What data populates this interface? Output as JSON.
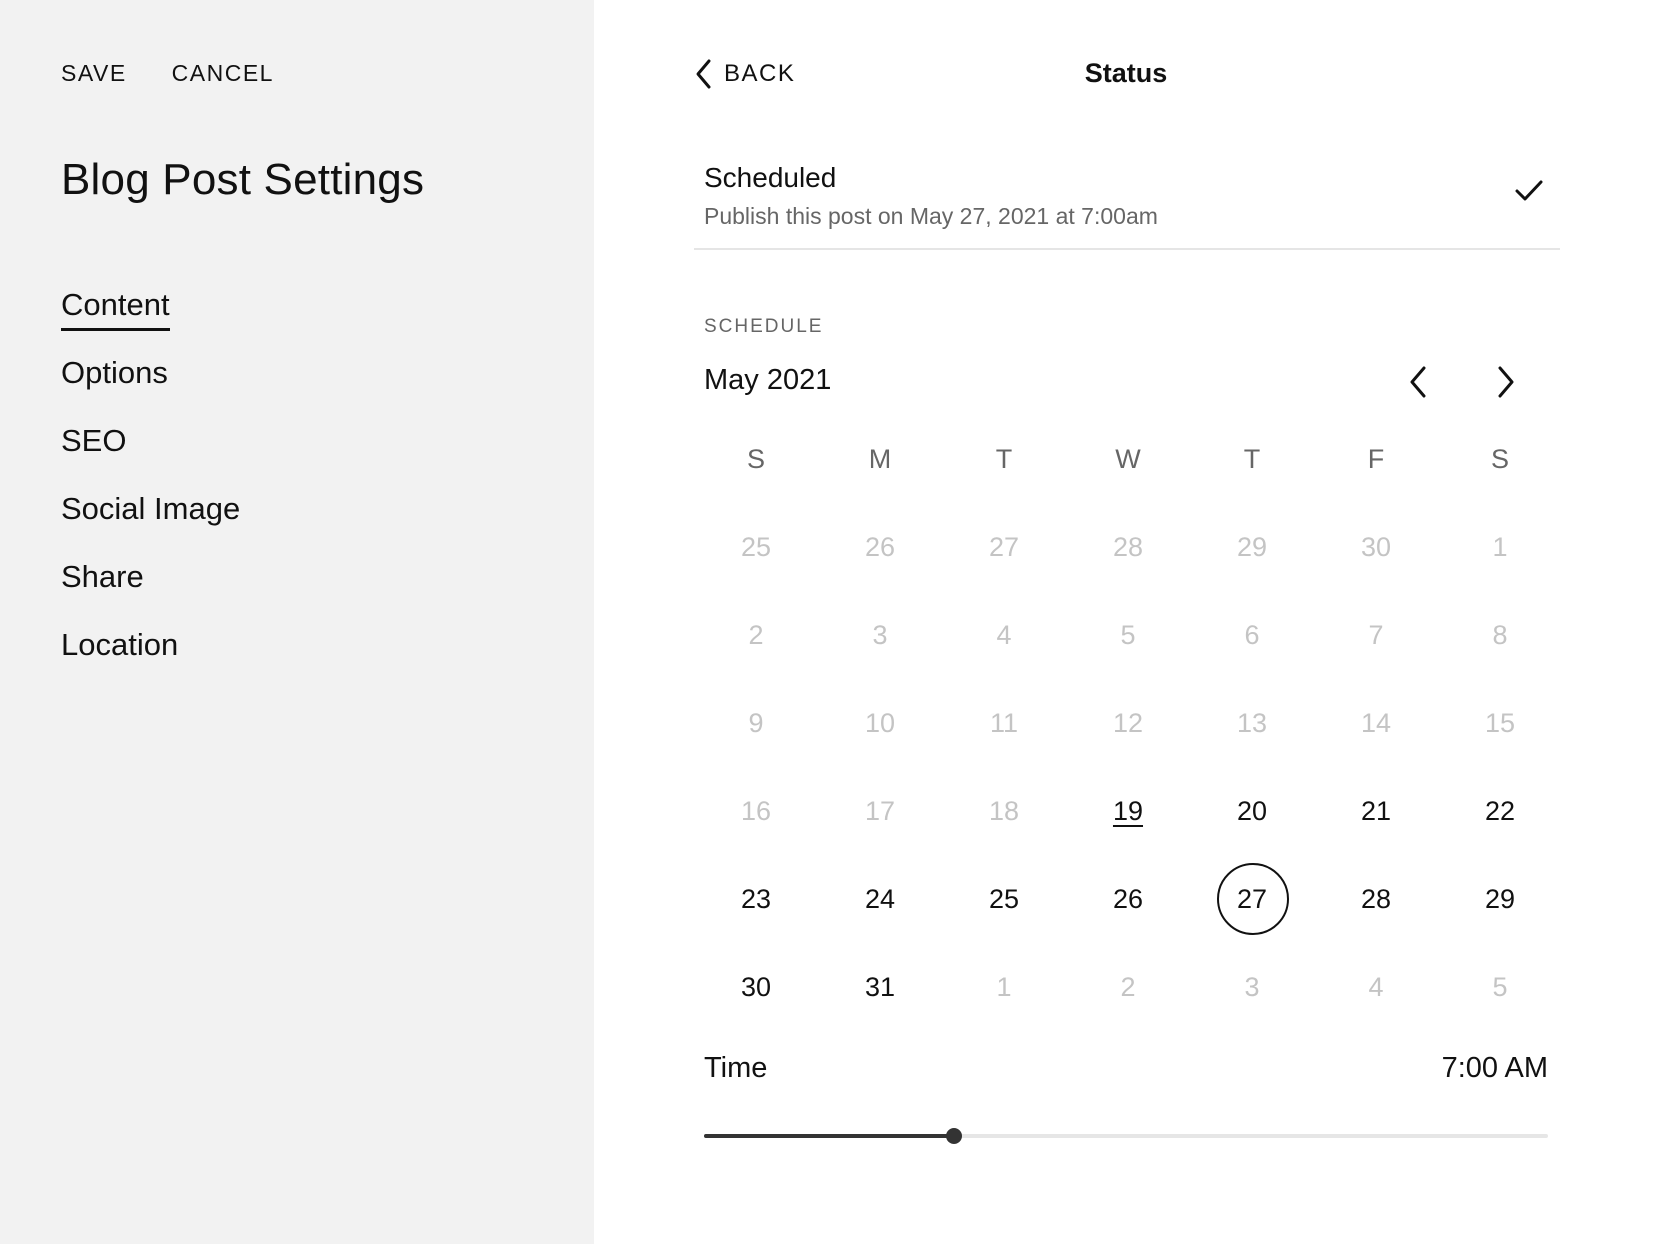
{
  "actions": {
    "save": "SAVE",
    "cancel": "CANCEL"
  },
  "panel": {
    "title": "Blog Post Settings",
    "nav": [
      {
        "label": "Content",
        "active": true
      },
      {
        "label": "Options"
      },
      {
        "label": "SEO"
      },
      {
        "label": "Social Image"
      },
      {
        "label": "Share"
      },
      {
        "label": "Location"
      }
    ]
  },
  "header": {
    "back_label": "BACK",
    "title": "Status"
  },
  "status": {
    "title": "Scheduled",
    "description": "Publish this post on May 27, 2021 at 7:00am",
    "checked": true
  },
  "schedule": {
    "section_label": "SCHEDULE",
    "month": "May 2021",
    "weekdays": [
      "S",
      "M",
      "T",
      "W",
      "T",
      "F",
      "S"
    ],
    "weeks": [
      [
        {
          "d": "25",
          "m": true
        },
        {
          "d": "26",
          "m": true
        },
        {
          "d": "27",
          "m": true
        },
        {
          "d": "28",
          "m": true
        },
        {
          "d": "29",
          "m": true
        },
        {
          "d": "30",
          "m": true
        },
        {
          "d": "1",
          "m": true
        }
      ],
      [
        {
          "d": "2",
          "m": true
        },
        {
          "d": "3",
          "m": true
        },
        {
          "d": "4",
          "m": true
        },
        {
          "d": "5",
          "m": true
        },
        {
          "d": "6",
          "m": true
        },
        {
          "d": "7",
          "m": true
        },
        {
          "d": "8",
          "m": true
        }
      ],
      [
        {
          "d": "9",
          "m": true
        },
        {
          "d": "10",
          "m": true
        },
        {
          "d": "11",
          "m": true
        },
        {
          "d": "12",
          "m": true
        },
        {
          "d": "13",
          "m": true
        },
        {
          "d": "14",
          "m": true
        },
        {
          "d": "15",
          "m": true
        }
      ],
      [
        {
          "d": "16",
          "m": true
        },
        {
          "d": "17",
          "m": true
        },
        {
          "d": "18",
          "m": true
        },
        {
          "d": "19",
          "today": true
        },
        {
          "d": "20"
        },
        {
          "d": "21"
        },
        {
          "d": "22"
        }
      ],
      [
        {
          "d": "23"
        },
        {
          "d": "24"
        },
        {
          "d": "25"
        },
        {
          "d": "26"
        },
        {
          "d": "27",
          "selected": true
        },
        {
          "d": "28"
        },
        {
          "d": "29"
        }
      ],
      [
        {
          "d": "30"
        },
        {
          "d": "31"
        },
        {
          "d": "1",
          "m": true
        },
        {
          "d": "2",
          "m": true
        },
        {
          "d": "3",
          "m": true
        },
        {
          "d": "4",
          "m": true
        },
        {
          "d": "5",
          "m": true
        }
      ]
    ]
  },
  "time": {
    "label": "Time",
    "value": "7:00 AM",
    "slider_fraction": 0.296
  },
  "icons": {
    "back": "chevron-left-icon",
    "check": "checkmark-icon",
    "prev": "chevron-left-icon",
    "next": "chevron-right-icon"
  }
}
